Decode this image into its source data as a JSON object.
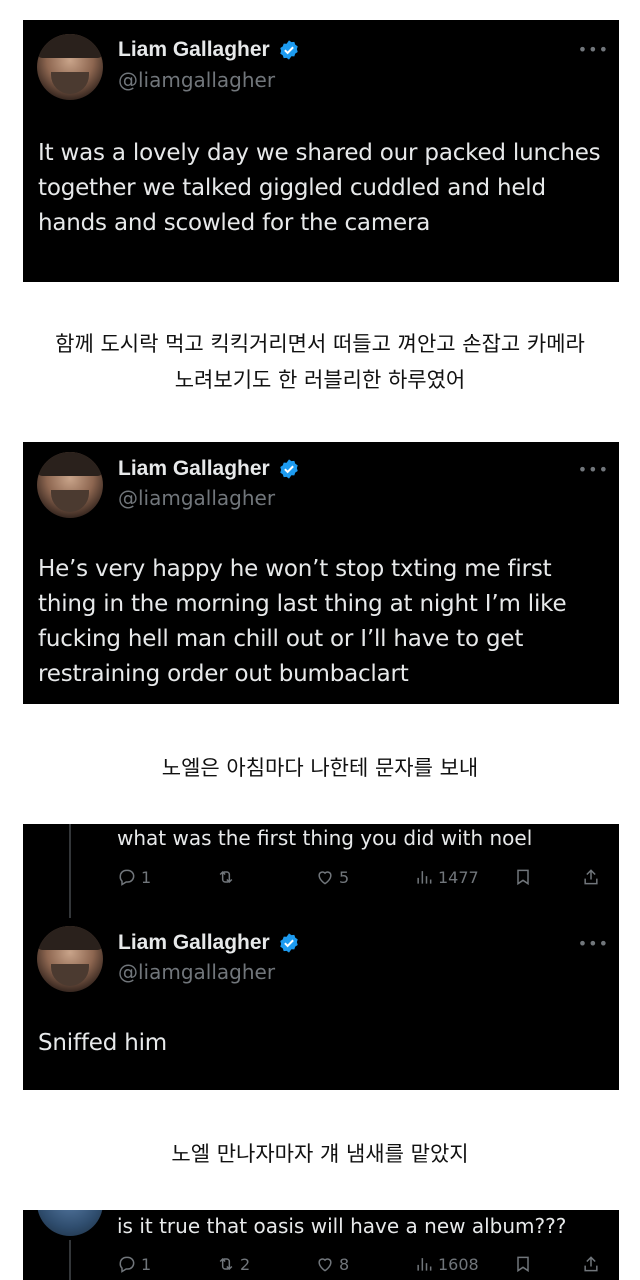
{
  "tweet1": {
    "name": "Liam Gallagher",
    "handle": "@liamgallagher",
    "more": "•••",
    "text": "It was a lovely day we shared our packed lunches\ntogether we talked giggled cuddled and held\nhands and scowled for the camera"
  },
  "caption1": "함께 도시락 먹고 킥킥거리면서 떠들고 껴안고 손잡고 카메라\n노려보기도 한 러블리한 하루였어",
  "tweet2": {
    "name": "Liam Gallagher",
    "handle": "@liamgallagher",
    "more": "•••",
    "text": "He’s very happy he won’t stop txting me first\nthing in the morning last thing at night I’m like\nfucking hell man chill out or I’ll have to get\nrestraining order out bumbaclart"
  },
  "caption2": "노엘은 아침마다 나한테 문자를 보내",
  "reply1": {
    "text": "what was the first thing you did with noel",
    "replies": "1",
    "retweets": "",
    "likes": "5",
    "views": "1477"
  },
  "tweet3": {
    "name": "Liam Gallagher",
    "handle": "@liamgallagher",
    "more": "•••",
    "text": "Sniffed him"
  },
  "caption3": "노엘 만나자마자 걔 냄새를 맡았지",
  "reply2": {
    "text": "is it true that oasis will have a new album???",
    "replies": "1",
    "retweets": "2",
    "likes": "8",
    "views": "1608"
  },
  "colors": {
    "card_bg": "#000000",
    "text": "#e7e9ea",
    "muted": "#71767b",
    "verified": "#1d9bf0",
    "caption": "#111111"
  },
  "icons": [
    "verified-badge-icon",
    "reply-icon",
    "retweet-icon",
    "like-icon",
    "views-icon",
    "bookmark-icon",
    "share-icon"
  ]
}
